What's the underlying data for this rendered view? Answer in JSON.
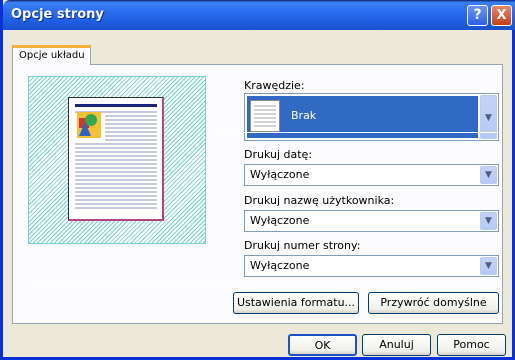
{
  "window": {
    "title": "Opcje strony"
  },
  "titlebar": {
    "help_glyph": "?",
    "close_glyph": "X"
  },
  "tabs": [
    {
      "label": "Opcje układu"
    }
  ],
  "borders": {
    "label": "Krawędzie:",
    "value": "Brak"
  },
  "print_date": {
    "label": "Drukuj datę:",
    "value": "Wyłączone"
  },
  "print_user": {
    "label": "Drukuj nazwę użytkownika:",
    "value": "Wyłączone"
  },
  "print_page_number": {
    "label": "Drukuj numer strony:",
    "value": "Wyłączone"
  },
  "buttons": {
    "format_settings": "Ustawienia formatu...",
    "restore_defaults": "Przywróć domyślne",
    "ok": "OK",
    "cancel": "Anuluj",
    "help": "Pomoc"
  },
  "icons": {
    "dropdown": "chevron-down-icon"
  },
  "colors": {
    "title_bar": "#2a6cf0",
    "selection": "#316ac5",
    "tab_accent": "#f9b03b"
  }
}
